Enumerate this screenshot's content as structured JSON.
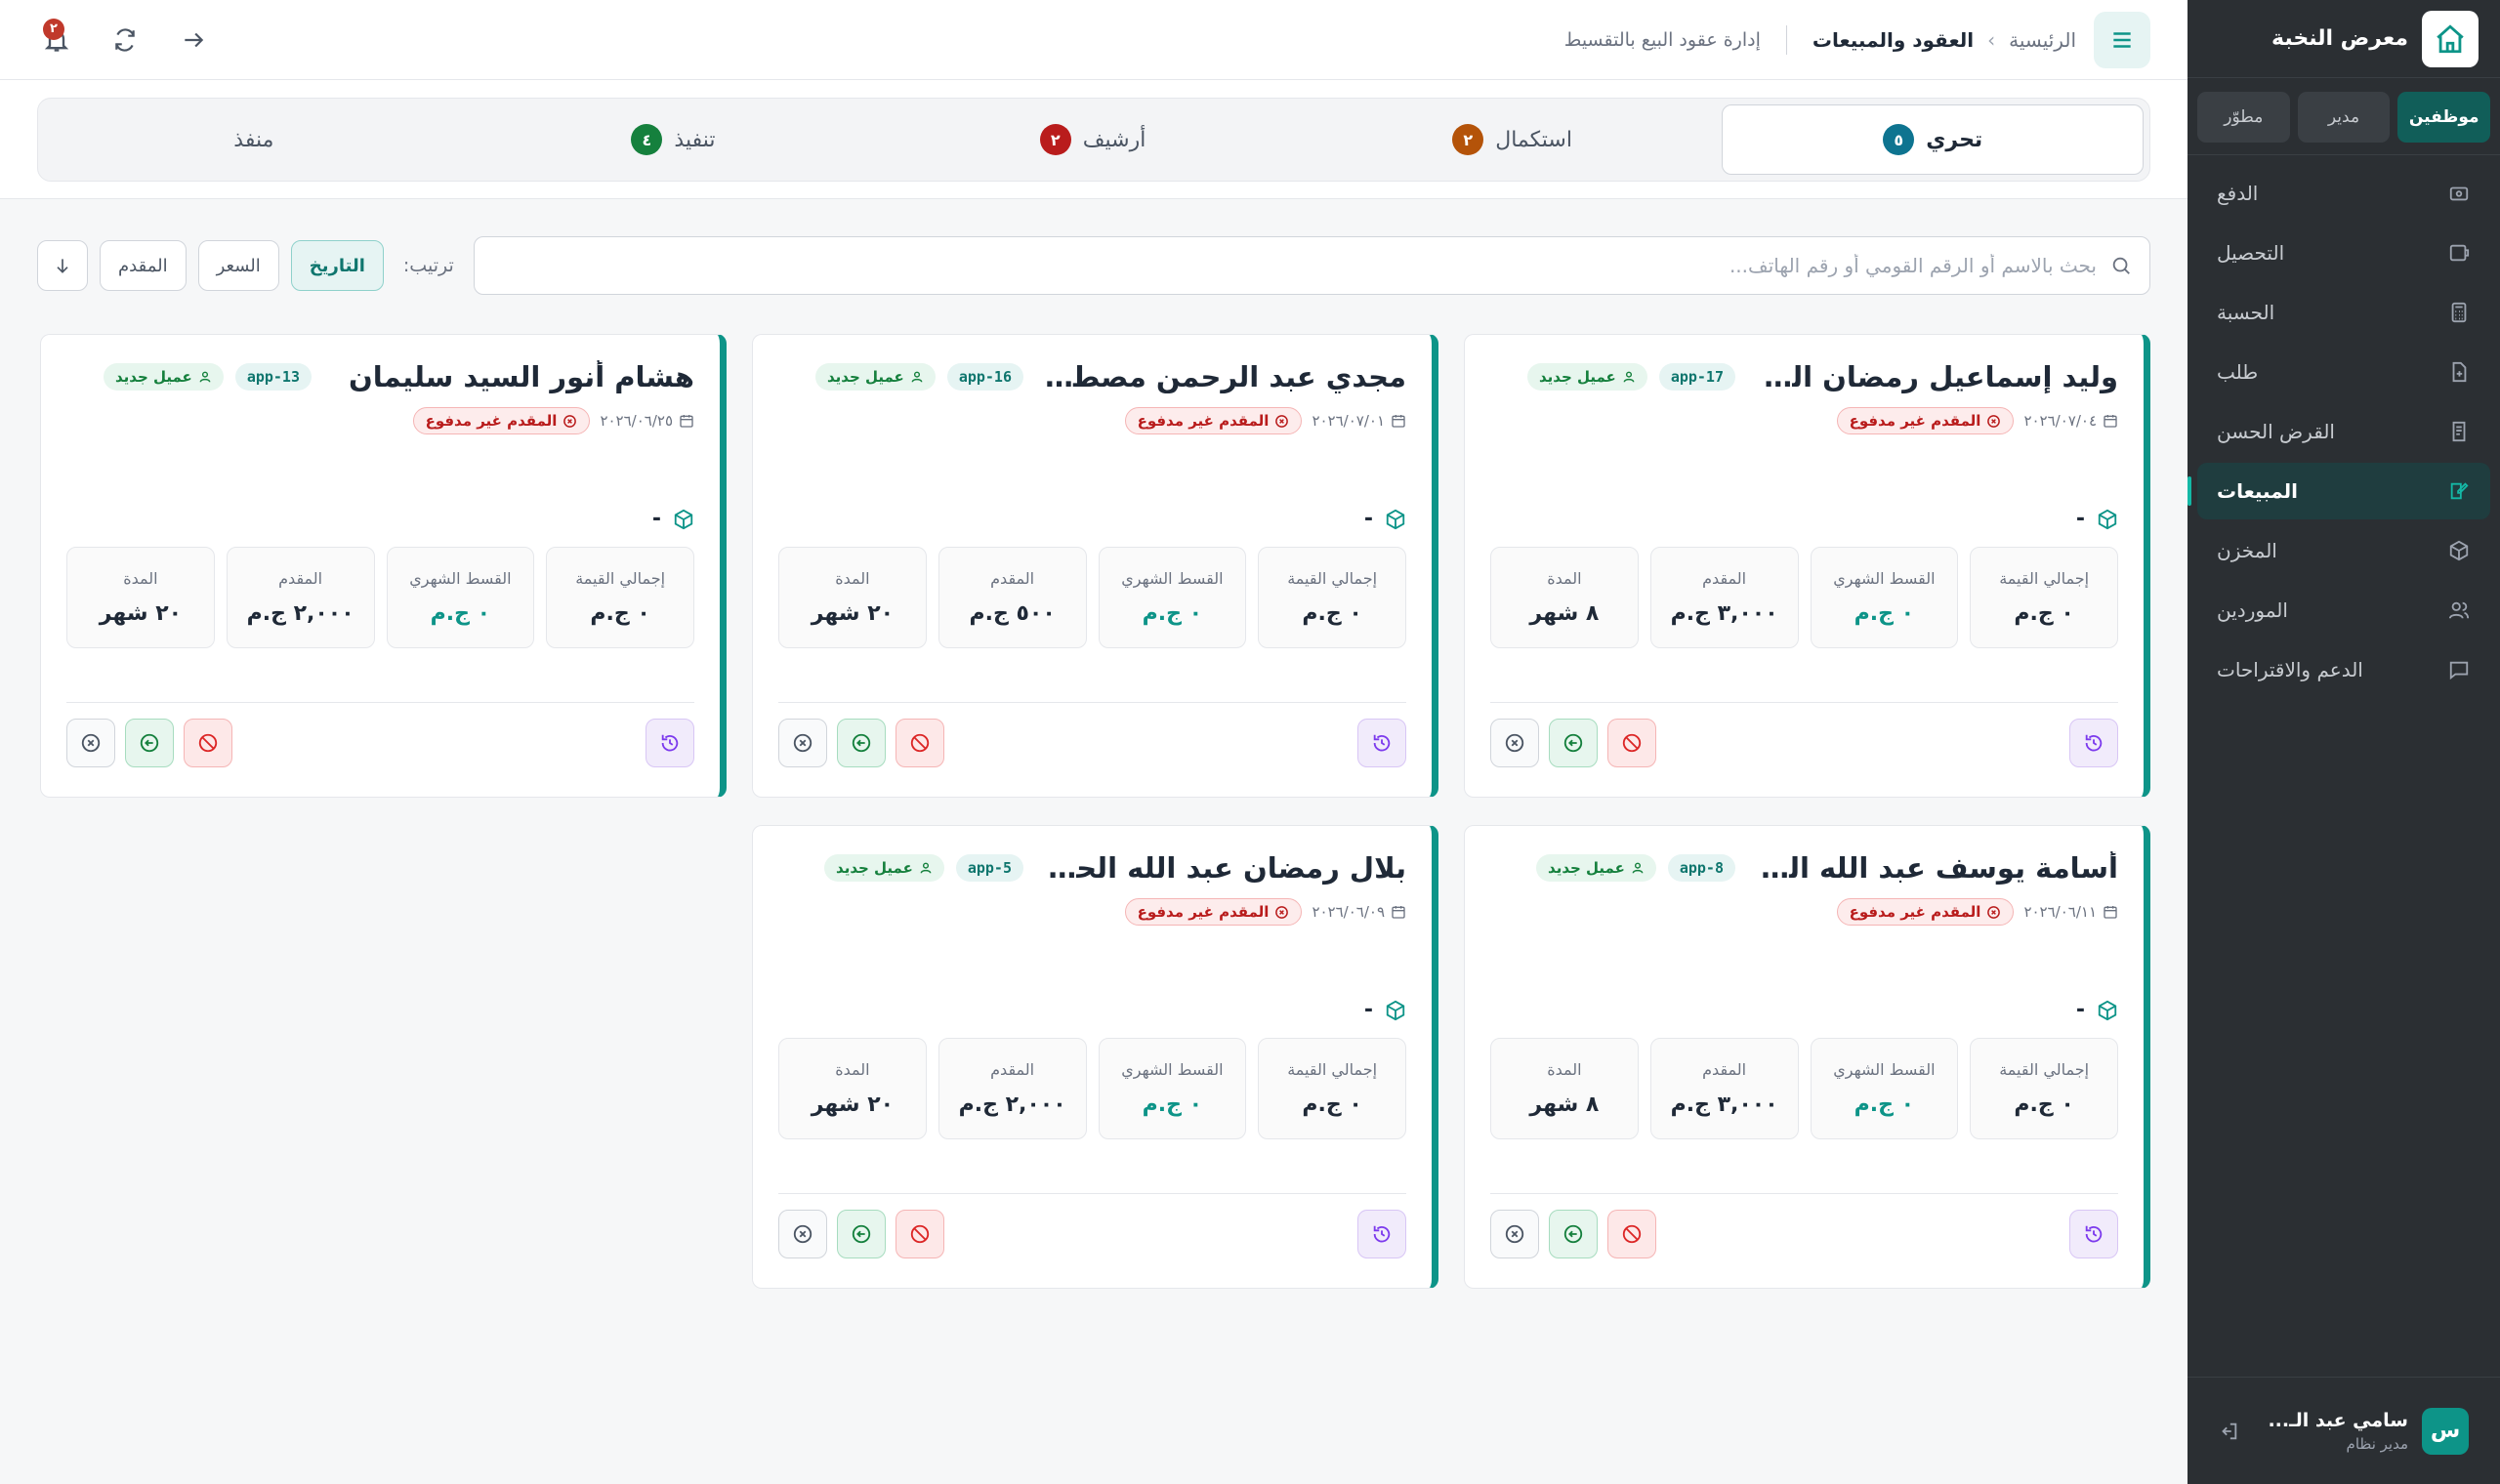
{
  "brand": {
    "title": "معرض النخبة"
  },
  "roles": [
    {
      "label": "موظفين",
      "active": true
    },
    {
      "label": "مدير",
      "active": false
    },
    {
      "label": "مطوّر",
      "active": false
    }
  ],
  "nav": [
    {
      "label": "الدفع",
      "icon": "wallet-icon"
    },
    {
      "label": "التحصيل",
      "icon": "collection-icon"
    },
    {
      "label": "الحسبة",
      "icon": "calculator-icon"
    },
    {
      "label": "طلب",
      "icon": "request-icon"
    },
    {
      "label": "القرض الحسن",
      "icon": "loan-icon"
    },
    {
      "label": "المبيعات",
      "icon": "sales-icon",
      "active": true
    },
    {
      "label": "المخزن",
      "icon": "box-icon"
    },
    {
      "label": "الموردين",
      "icon": "users-icon"
    },
    {
      "label": "الدعم والاقتراحات",
      "icon": "chat-icon"
    }
  ],
  "user": {
    "initial": "س",
    "name": "سامي عبد الـ...",
    "role": "مدير نظام"
  },
  "topbar": {
    "home": "الرئيسية",
    "current": "العقود والمبيعات",
    "subtitle": "إدارة عقود البيع بالتقسيط",
    "notifications": "٢"
  },
  "tabs": [
    {
      "label": "تحري",
      "count": "٥",
      "color": "#0e7490",
      "active": true
    },
    {
      "label": "استكمال",
      "count": "٢",
      "color": "#b45309"
    },
    {
      "label": "أرشيف",
      "count": "٢",
      "color": "#b91c1c"
    },
    {
      "label": "تنفيذ",
      "count": "٤",
      "color": "#15803d"
    },
    {
      "label": "منفذ",
      "count": ""
    }
  ],
  "search": {
    "placeholder": "بحث بالاسم أو الرقم القومي أو رقم الهاتف..."
  },
  "sort": {
    "label": "ترتيب:",
    "options": [
      "التاريخ",
      "السعر",
      "المقدم"
    ]
  },
  "labels": {
    "total": "إجمالي القيمة",
    "monthly": "القسط الشهري",
    "down": "المقدم",
    "duration": "المدة",
    "new_client": "عميل جديد",
    "unpaid": "المقدم غير مدفوع"
  },
  "cards": [
    {
      "name": "وليد إسماعيل رمضان الشنـ...",
      "app": "app-17",
      "date": "٢٠٢٦/٠٧/٠٤",
      "product": "-",
      "total": "٠ ج.م",
      "monthly": "٠ ج.م",
      "down": "٣,٠٠٠ ج.م",
      "duration": "٨ شهر"
    },
    {
      "name": "مجدي عبد الرحمن مصطفى...",
      "app": "app-16",
      "date": "٢٠٢٦/٠٧/٠١",
      "product": "-",
      "total": "٠ ج.م",
      "monthly": "٠ ج.م",
      "down": "٥٠٠ ج.م",
      "duration": "٢٠ شهر"
    },
    {
      "name": "هشام أنور السيد سليمان",
      "app": "app-13",
      "date": "٢٠٢٦/٠٦/٢٥",
      "product": "-",
      "total": "٠ ج.م",
      "monthly": "٠ ج.م",
      "down": "٢,٠٠٠ ج.م",
      "duration": "٢٠ شهر"
    },
    {
      "name": "أسامة يوسف عبد الله المصـ...",
      "app": "app-8",
      "date": "٢٠٢٦/٠٦/١١",
      "product": "-",
      "total": "٠ ج.م",
      "monthly": "٠ ج.م",
      "down": "٣,٠٠٠ ج.م",
      "duration": "٨ شهر"
    },
    {
      "name": "بلال رمضان عبد الله الحديدي",
      "app": "app-5",
      "date": "٢٠٢٦/٠٦/٠٩",
      "product": "-",
      "total": "٠ ج.م",
      "monthly": "٠ ج.م",
      "down": "٢,٠٠٠ ج.م",
      "duration": "٢٠ شهر"
    }
  ]
}
